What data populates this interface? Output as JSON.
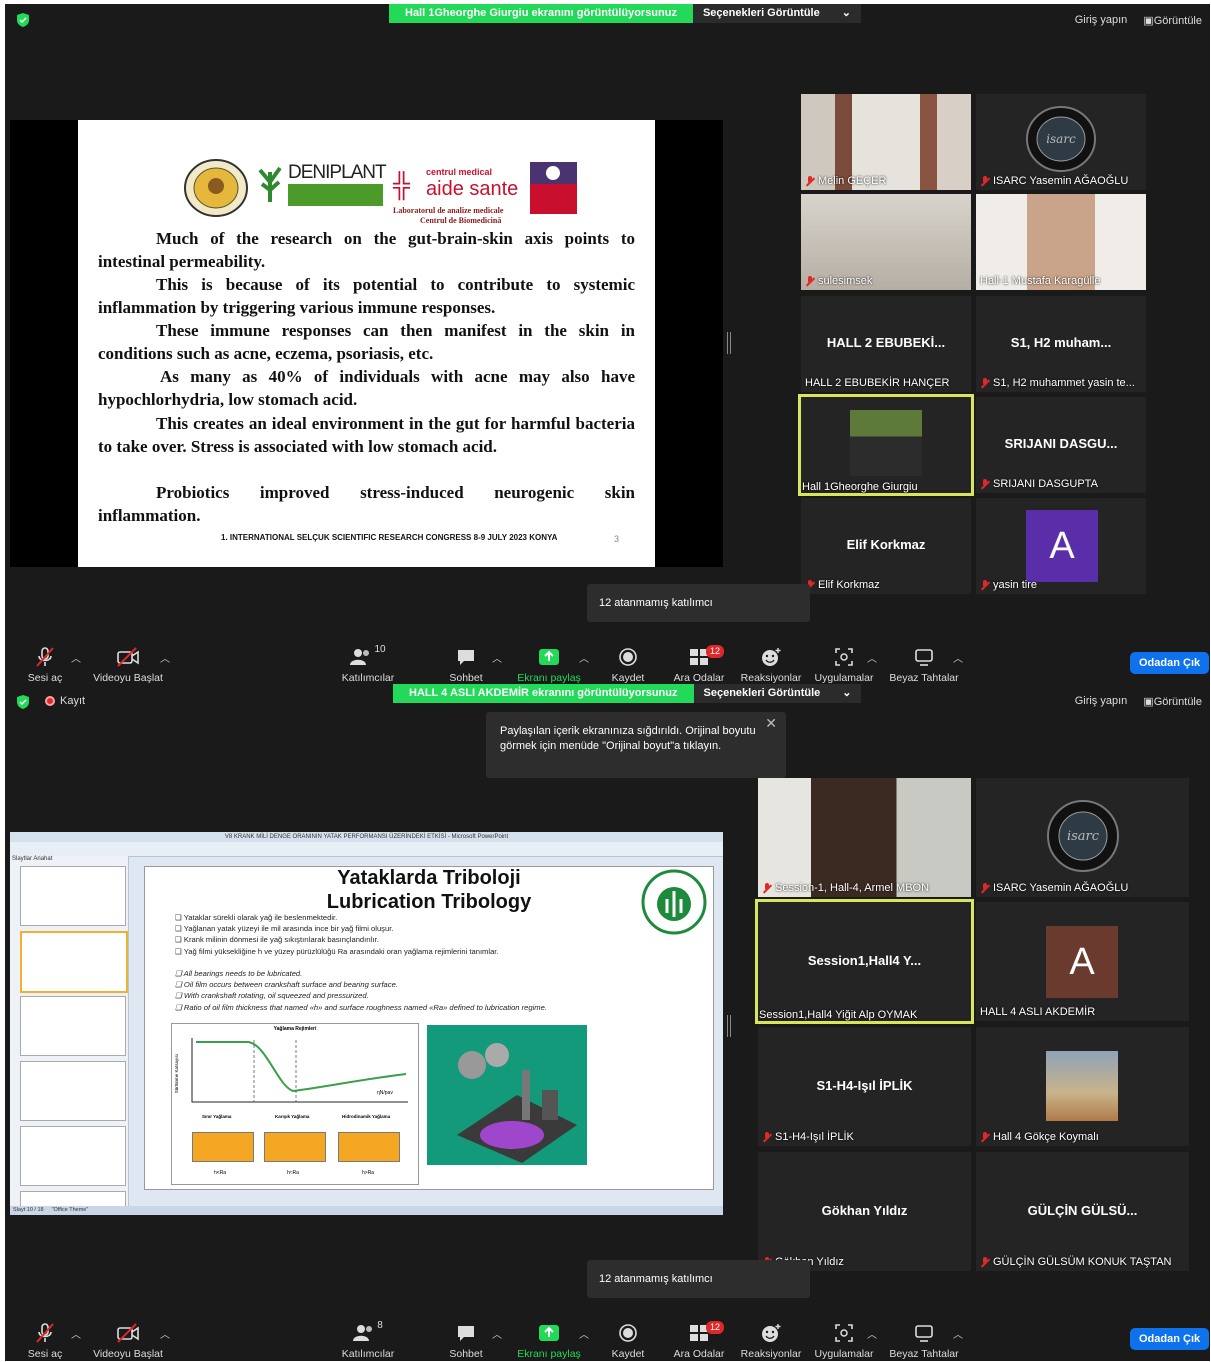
{
  "window1": {
    "share_banner": "Hall 1Gheorghe Giurgiu ekranını görüntülüyorsunuz",
    "view_options": "Seçenekleri Görüntüle",
    "sign_in": "Giriş yapın",
    "view": "Görüntüle",
    "slide": {
      "paragraphs": [
        "Much of the research on the gut-brain-skin axis points to intestinal permeability.",
        "This is because of its potential to contribute to systemic inflammation by triggering various immune responses.",
        "These immune responses can then manifest in the skin in conditions such as acne, eczema, psoriasis, etc.",
        "As many as 40% of individuals with acne may also have hypochlorhydria, low stomach acid.",
        "This creates an ideal environment in the gut for harmful bacteria to take over. Stress is associated with low stomach acid.",
        "Probiotics improved stress-induced neurogenic skin inflammation."
      ],
      "footer": "1. INTERNATIONAL SELÇUK SCIENTIFIC RESEARCH CONGRESS 8-9 JULY 2023 KONYA",
      "page": "3",
      "logo_deniplant": "DENIPLANT",
      "logo_centrul": "centrul medical",
      "logo_aide": "aide sante",
      "logo_lab": "Laboratorul de analize medicale",
      "logo_cb": "Centrul de Biomedicină"
    },
    "participants": [
      {
        "name": "Melin GEÇER",
        "muted": true
      },
      {
        "name": "ISARC Yasemin AĞAOĞLU",
        "muted": true
      },
      {
        "name": "sulesimsek",
        "muted": true
      },
      {
        "name": "Hall-1 Mustafa Karagülle",
        "muted": false
      },
      {
        "big": "HALL 2 EBUBEKİ...",
        "name": "HALL 2 EBUBEKİR HANÇER",
        "muted": false
      },
      {
        "big": "S1, H2 muham...",
        "name": "S1, H2 muhammet yasin te...",
        "muted": true
      },
      {
        "name": "Hall 1Gheorghe Giurgiu",
        "muted": false
      },
      {
        "big": "SRIJANI DASGU...",
        "name": "SRIJANI DASGUPTA",
        "muted": true
      },
      {
        "big": "Elif Korkmaz",
        "name": "Elif Korkmaz",
        "muted": true
      },
      {
        "avatar": "A",
        "name": "yasin tire",
        "muted": true
      }
    ],
    "unassigned_tooltip": "12 atanmamış katılımcı",
    "toolbar": {
      "mic": "Sesi aç",
      "video": "Videoyu Başlat",
      "participants": "Katılımcılar",
      "participants_count": "10",
      "chat": "Sohbet",
      "share": "Ekranı paylaş",
      "record": "Kaydet",
      "breakout": "Ara Odalar",
      "breakout_badge": "12",
      "reactions": "Reaksiyonlar",
      "apps": "Uygulamalar",
      "whiteboard": "Beyaz Tahtalar",
      "leave": "Odadan Çık"
    }
  },
  "window2": {
    "recording": "Kayıt",
    "share_banner": "HALL 4 ASLI AKDEMİR ekranını görüntülüyorsunuz",
    "view_options": "Seçenekleri Görüntüle",
    "sign_in": "Giriş yapın",
    "view": "Görüntüle",
    "fit_tooltip": "Paylaşılan içerik ekranınıza sığdırıldı. Orijinal boyutu görmek için menüde \"Orijinal boyut\"a tıklayın.",
    "ppt": {
      "window_title": "V8 KRANK MİLİ DENGE ORANININ YATAK PERFORMANSI ÜZERİNDEKİ ETKİSİ - Microsoft PowerPoint",
      "title_tr": "Yataklarda Triboloji",
      "title_en": "Lubrication Tribology",
      "bullets_tr": [
        "Yataklar sürekli olarak yağ ile beslenmektedir.",
        "Yağlanan yatak yüzeyi ile mil arasında ince bir yağ filmi oluşur.",
        "Krank milinin dönmesi ile yağ sıkıştırılarak basınçlandırılır.",
        "Yağ filmi yüksekliğine h ve yüzey pürüzlülüğü Ra arasındaki oran yağlama rejimlerini tanımlar."
      ],
      "bullets_en": [
        "All bearings needs to be lubricated.",
        "Oil film occurs between crankshaft surface and bearing surface.",
        "With crankshaft rotating, oil squeezed and pressurized.",
        "Ratio of oil film thickness that named «h» and surface roughness named «Ra» defined to lubrication regime."
      ],
      "chart_title": "Yağlama Rejimleri",
      "chart_ylabel": "Sürtünme Katsayısı",
      "chart_xlabel": "ηN/pav",
      "regimes": [
        "Sınır Yağlama",
        "Karışık Yağlama",
        "Hidrodinamik Yağlama"
      ],
      "regime_ratios": [
        "h<Ra",
        "h≈Ra",
        "h>Ra"
      ],
      "slide_status": "Slayt 10 / 18",
      "theme": "\"Office Theme\"",
      "panel_tabs": [
        "Slaytlar",
        "Anahat"
      ]
    },
    "participants": [
      {
        "name": "Session-1, Hall-4, Armel MBON",
        "muted": true
      },
      {
        "name": "ISARC Yasemin AĞAOĞLU",
        "muted": true
      },
      {
        "big": "Session1,Hall4  Y...",
        "name": "Session1,Hall4 Yiğit Alp OYMAK",
        "muted": false
      },
      {
        "avatar": "A",
        "name": "HALL 4 ASLI AKDEMİR",
        "muted": false
      },
      {
        "big": "S1-H4-Işıl İPLİK",
        "name": "S1-H4-Işıl İPLİK",
        "muted": true
      },
      {
        "name": "Hall 4 Gökçe Koymalı",
        "muted": true
      },
      {
        "big": "Gökhan Yıldız",
        "name": "Gökhan Yıldız",
        "muted": true
      },
      {
        "big": "GÜLÇİN GÜLSÜ...",
        "name": "GÜLÇİN GÜLSÜM KONUK TAŞTAN",
        "muted": true
      }
    ],
    "unassigned_tooltip": "12 atanmamış katılımcı",
    "toolbar": {
      "mic": "Sesi aç",
      "video": "Videoyu Başlat",
      "participants": "Katılımcılar",
      "participants_count": "8",
      "chat": "Sohbet",
      "share": "Ekranı paylaş",
      "record": "Kaydet",
      "breakout": "Ara Odalar",
      "breakout_badge": "12",
      "reactions": "Reaksiyonlar",
      "apps": "Uygulamalar",
      "whiteboard": "Beyaz Tahtalar",
      "leave": "Odadan Çık"
    }
  },
  "colors": {
    "share_green": "#23d959",
    "leave_blue": "#0e72ed",
    "mute_red": "#e02828",
    "active_speaker": "#d7e65a",
    "avatar_purple": "#5a2ea8",
    "avatar_brown": "#6b3a2e"
  }
}
